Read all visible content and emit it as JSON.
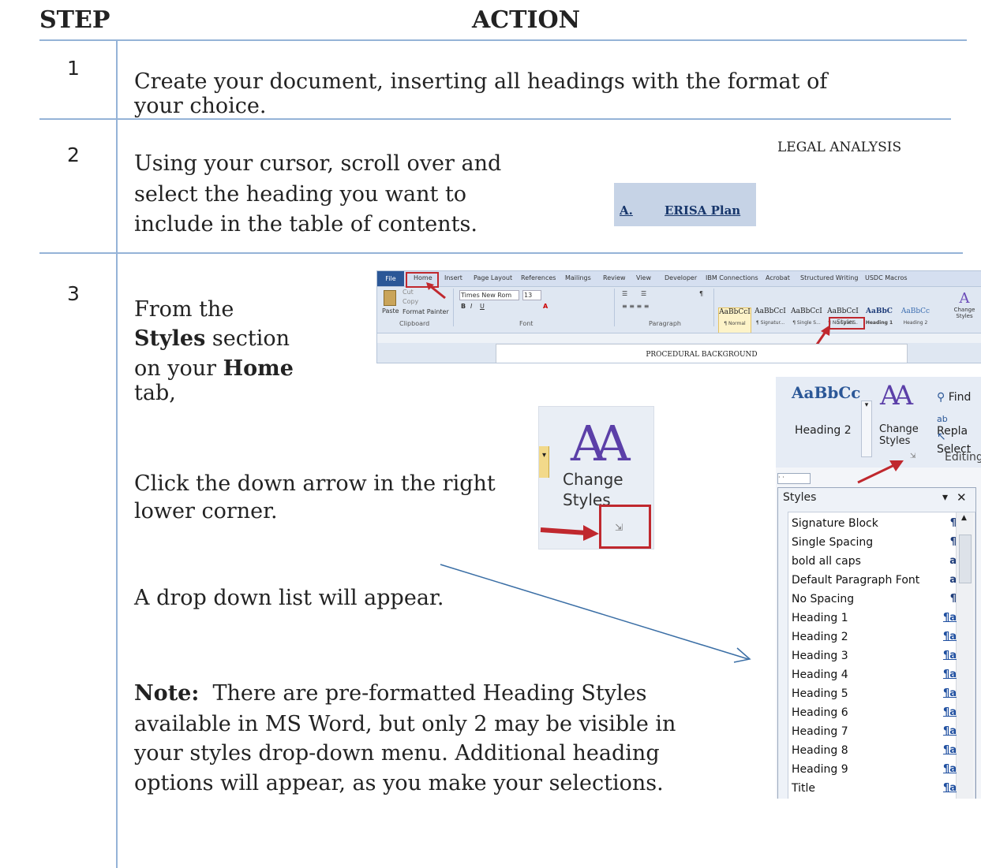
{
  "header": {
    "step": "STEP",
    "action": "ACTION"
  },
  "steps": [
    {
      "num": "1",
      "text": "Create your document, inserting all headings with the format of your choice."
    },
    {
      "num": "2",
      "text_lines": [
        "Using your cursor, scroll over and",
        "select the heading you want to",
        "include in the table of contents."
      ]
    },
    {
      "num": "3"
    }
  ],
  "step2_doc": {
    "title": "LEGAL ANALYSIS",
    "heading_letter": "A.",
    "heading_text": "ERISA Plan"
  },
  "step3": {
    "line1": "From the",
    "styles_word": "Styles",
    "section_on": "section",
    "on_your": "on your",
    "home_word": "Home",
    "tab": "tab,",
    "click_lines": [
      "Click the down arrow in the right",
      "lower corner."
    ],
    "dropdown": "A drop down list will appear.",
    "note_label": "Note:",
    "note_lines": [
      "There are pre-formatted Heading Styles",
      "available in MS Word, but only 2 may be visible in",
      "your styles drop-down menu.  Additional heading",
      "options will appear, as you make your selections."
    ]
  },
  "ribbon": {
    "tabs": [
      "File",
      "Home",
      "Insert",
      "Page Layout",
      "References",
      "Mailings",
      "Review",
      "View",
      "Developer",
      "IBM Connections",
      "Acrobat",
      "Structured Writing",
      "USDC Macros"
    ],
    "paste": "Paste",
    "cut": "Cut",
    "copy": "Copy",
    "format_painter": "Format Painter",
    "clipboard": "Clipboard",
    "font_name": "Times New Rom",
    "font_size": "13",
    "font_group": "Font",
    "paragraph_group": "Paragraph",
    "styles_group": "Styles",
    "style_chips": [
      {
        "sample": "AaBbCcI",
        "name": "¶ Normal"
      },
      {
        "sample": "AaBbCcI",
        "name": "¶ Signatur..."
      },
      {
        "sample": "AaBbCcI",
        "name": "¶ Single S..."
      },
      {
        "sample": "AaBbCcI",
        "name": "¶ No Spaci..."
      },
      {
        "sample": "AaBbC",
        "name": "Heading 1"
      },
      {
        "sample": "AaBbCc",
        "name": "Heading 2"
      }
    ],
    "change_styles": "Change Styles",
    "doc_text": "PROCEDURAL BACKGROUND"
  },
  "zoom": {
    "change": "Change",
    "styles": "Styles"
  },
  "styles_panel": {
    "heading2_sample": "AaBbCc",
    "heading2_label": "Heading 2",
    "change": "Change",
    "styles": "Styles",
    "find": "Find",
    "replace": "Repla",
    "select": "Select",
    "editing": "Editing",
    "title": "Styles",
    "items": [
      {
        "name": "Signature Block",
        "mark": "¶"
      },
      {
        "name": "Single Spacing",
        "mark": "¶"
      },
      {
        "name": "bold all caps",
        "mark": "a"
      },
      {
        "name": "Default Paragraph Font",
        "mark": "a"
      },
      {
        "name": "No Spacing",
        "mark": "¶"
      },
      {
        "name": "Heading 1",
        "mark": "¶a"
      },
      {
        "name": "Heading 2",
        "mark": "¶a"
      },
      {
        "name": "Heading 3",
        "mark": "¶a"
      },
      {
        "name": "Heading 4",
        "mark": "¶a"
      },
      {
        "name": "Heading 5",
        "mark": "¶a"
      },
      {
        "name": "Heading 6",
        "mark": "¶a"
      },
      {
        "name": "Heading 7",
        "mark": "¶a"
      },
      {
        "name": "Heading 8",
        "mark": "¶a"
      },
      {
        "name": "Heading 9",
        "mark": "¶a"
      },
      {
        "name": "Title",
        "mark": "¶a"
      }
    ]
  },
  "colors": {
    "rule": "#95b3d7",
    "highlight": "#c6d3e6",
    "red": "#c0282e",
    "arrow": "#3a6ea5"
  }
}
